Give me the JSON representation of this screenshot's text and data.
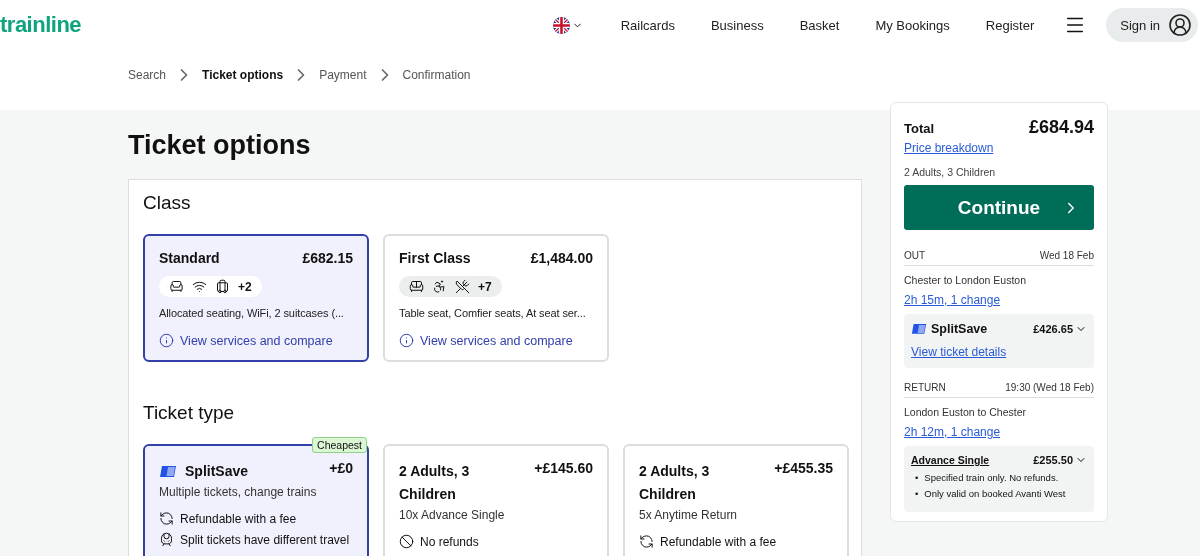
{
  "header": {
    "logo": "trainline",
    "nav": [
      "Railcards",
      "Business",
      "Basket",
      "My Bookings",
      "Register"
    ],
    "sign_in": "Sign in"
  },
  "breadcrumb": [
    {
      "label": "Search",
      "selected": false
    },
    {
      "label": "Ticket options",
      "selected": true
    },
    {
      "label": "Payment",
      "selected": false
    },
    {
      "label": "Confirmation",
      "selected": false
    }
  ],
  "title": "Ticket options",
  "class_section": {
    "title": "Class",
    "options": [
      {
        "name": "Standard",
        "price": "£682.15",
        "selected": true,
        "amenities": [
          {
            "kind": "seat"
          },
          {
            "kind": "wifi"
          },
          {
            "kind": "luggage"
          }
        ],
        "more": "+2",
        "summary": "Allocated seating, WiFi, 2 suitcases (...",
        "link": "View services and compare"
      },
      {
        "name": "First Class",
        "price": "£1,484.00",
        "selected": false,
        "amenities": [
          {
            "kind": "comfy-seat"
          },
          {
            "kind": "accessible"
          },
          {
            "kind": "dining"
          }
        ],
        "more": "+7",
        "summary": "Table seat, Comfier seats, At seat ser...",
        "link": "View services and compare"
      }
    ]
  },
  "ticket_section": {
    "title": "Ticket type",
    "options": [
      {
        "kind": "splitsave",
        "title": "SplitSave",
        "price": "+£0",
        "selected": true,
        "badge": "Cheapest",
        "subtitle": "Multiple tickets, change trains",
        "features": [
          {
            "kind": "refund-fee",
            "text": "Refundable with a fee"
          },
          {
            "kind": "split",
            "text": "Split tickets have different travel"
          }
        ]
      },
      {
        "kind": "fare",
        "title": "2 Adults, 3 Children",
        "price": "+£145.60",
        "selected": false,
        "subtitle": "10x Advance Single",
        "features": [
          {
            "kind": "no-refund",
            "text": "No refunds"
          }
        ]
      },
      {
        "kind": "fare",
        "title": "2 Adults, 3 Children",
        "price": "+£455.35",
        "selected": false,
        "subtitle": "5x Anytime Return",
        "features": [
          {
            "kind": "refund-fee",
            "text": "Refundable with a fee"
          }
        ]
      }
    ]
  },
  "summary": {
    "total_label": "Total",
    "total": "£684.94",
    "breakdown_link": "Price breakdown",
    "passengers": "2 Adults, 3 Children",
    "continue": "Continue",
    "journeys": [
      {
        "label": "OUT",
        "date": "Wed 18 Feb",
        "route": "Chester to London Euston",
        "duration": "2h 15m, 1 change",
        "ticket": {
          "kind": "splitsave",
          "name": "SplitSave",
          "price": "£426.65",
          "link": "View ticket details"
        }
      },
      {
        "label": "RETURN",
        "date": "19:30 (Wed 18 Feb)",
        "route": "London Euston to Chester",
        "duration": "2h 12m, 1 change",
        "ticket": {
          "kind": "fare",
          "name": "Advance Single",
          "price": "£255.50",
          "bullet": "•",
          "notes": [
            "Specified train only. No refunds.",
            "Only valid on booked Avanti West"
          ]
        }
      }
    ]
  }
}
